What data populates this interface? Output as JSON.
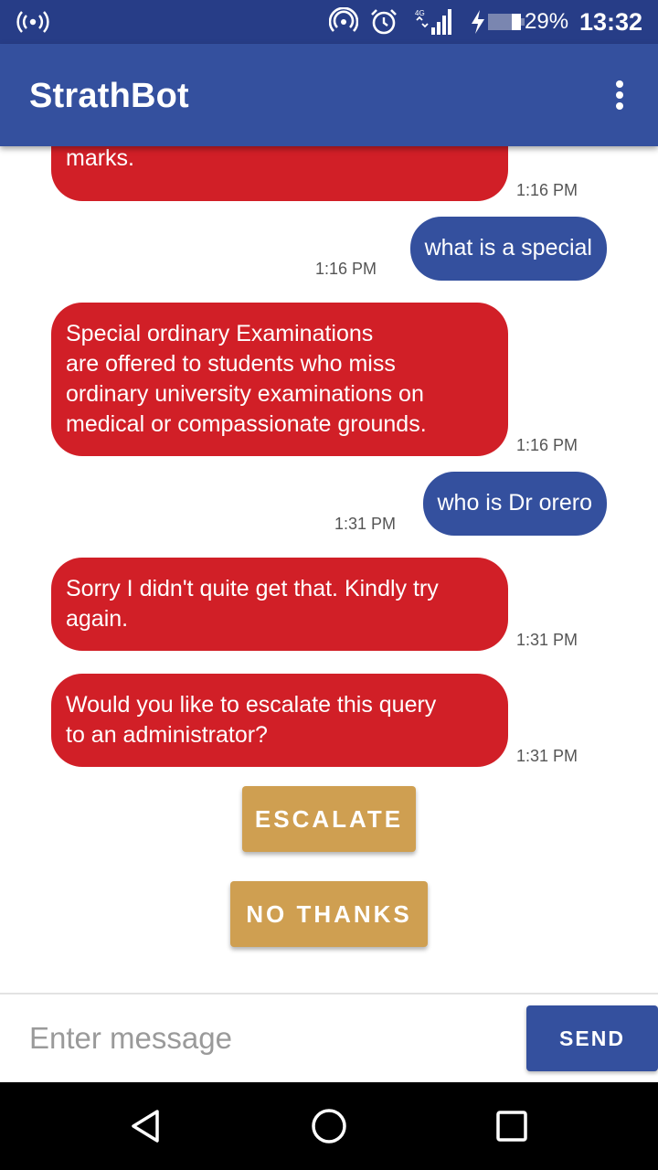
{
  "status_bar": {
    "hotspot_icon": "broadcast-icon",
    "network_label": "4G",
    "battery": "29%",
    "time": "13:32"
  },
  "app_bar": {
    "title": "StrathBot",
    "menu_icon": "overflow-menu-icon"
  },
  "messages": [
    {
      "sender": "bot",
      "text": "include continuous assessment\nmarks.",
      "time": "1:16 PM"
    },
    {
      "sender": "user",
      "text": "what is a special",
      "time": "1:16 PM"
    },
    {
      "sender": "bot",
      "text": "Special ordinary Examinations\nare offered to students who miss\nordinary university examinations on\nmedical or compassionate grounds.",
      "time": "1:16 PM"
    },
    {
      "sender": "user",
      "text": "who is Dr orero",
      "time": "1:31 PM"
    },
    {
      "sender": "bot",
      "text": "Sorry I didn't quite get that. Kindly try\nagain.",
      "time": "1:31 PM"
    },
    {
      "sender": "bot",
      "text": "Would you like to escalate this query\nto an administrator?",
      "time": "1:31 PM"
    }
  ],
  "actions": {
    "escalate_label": "ESCALATE",
    "no_thanks_label": "NO THANKS"
  },
  "composer": {
    "placeholder": "Enter message",
    "value": "",
    "send_label": "SEND"
  },
  "colors": {
    "app_bar": "#34509e",
    "status_bar": "#273d87",
    "bot_bubble": "#d11f27",
    "user_bubble": "#34509e",
    "action_button": "#cf9f51"
  }
}
